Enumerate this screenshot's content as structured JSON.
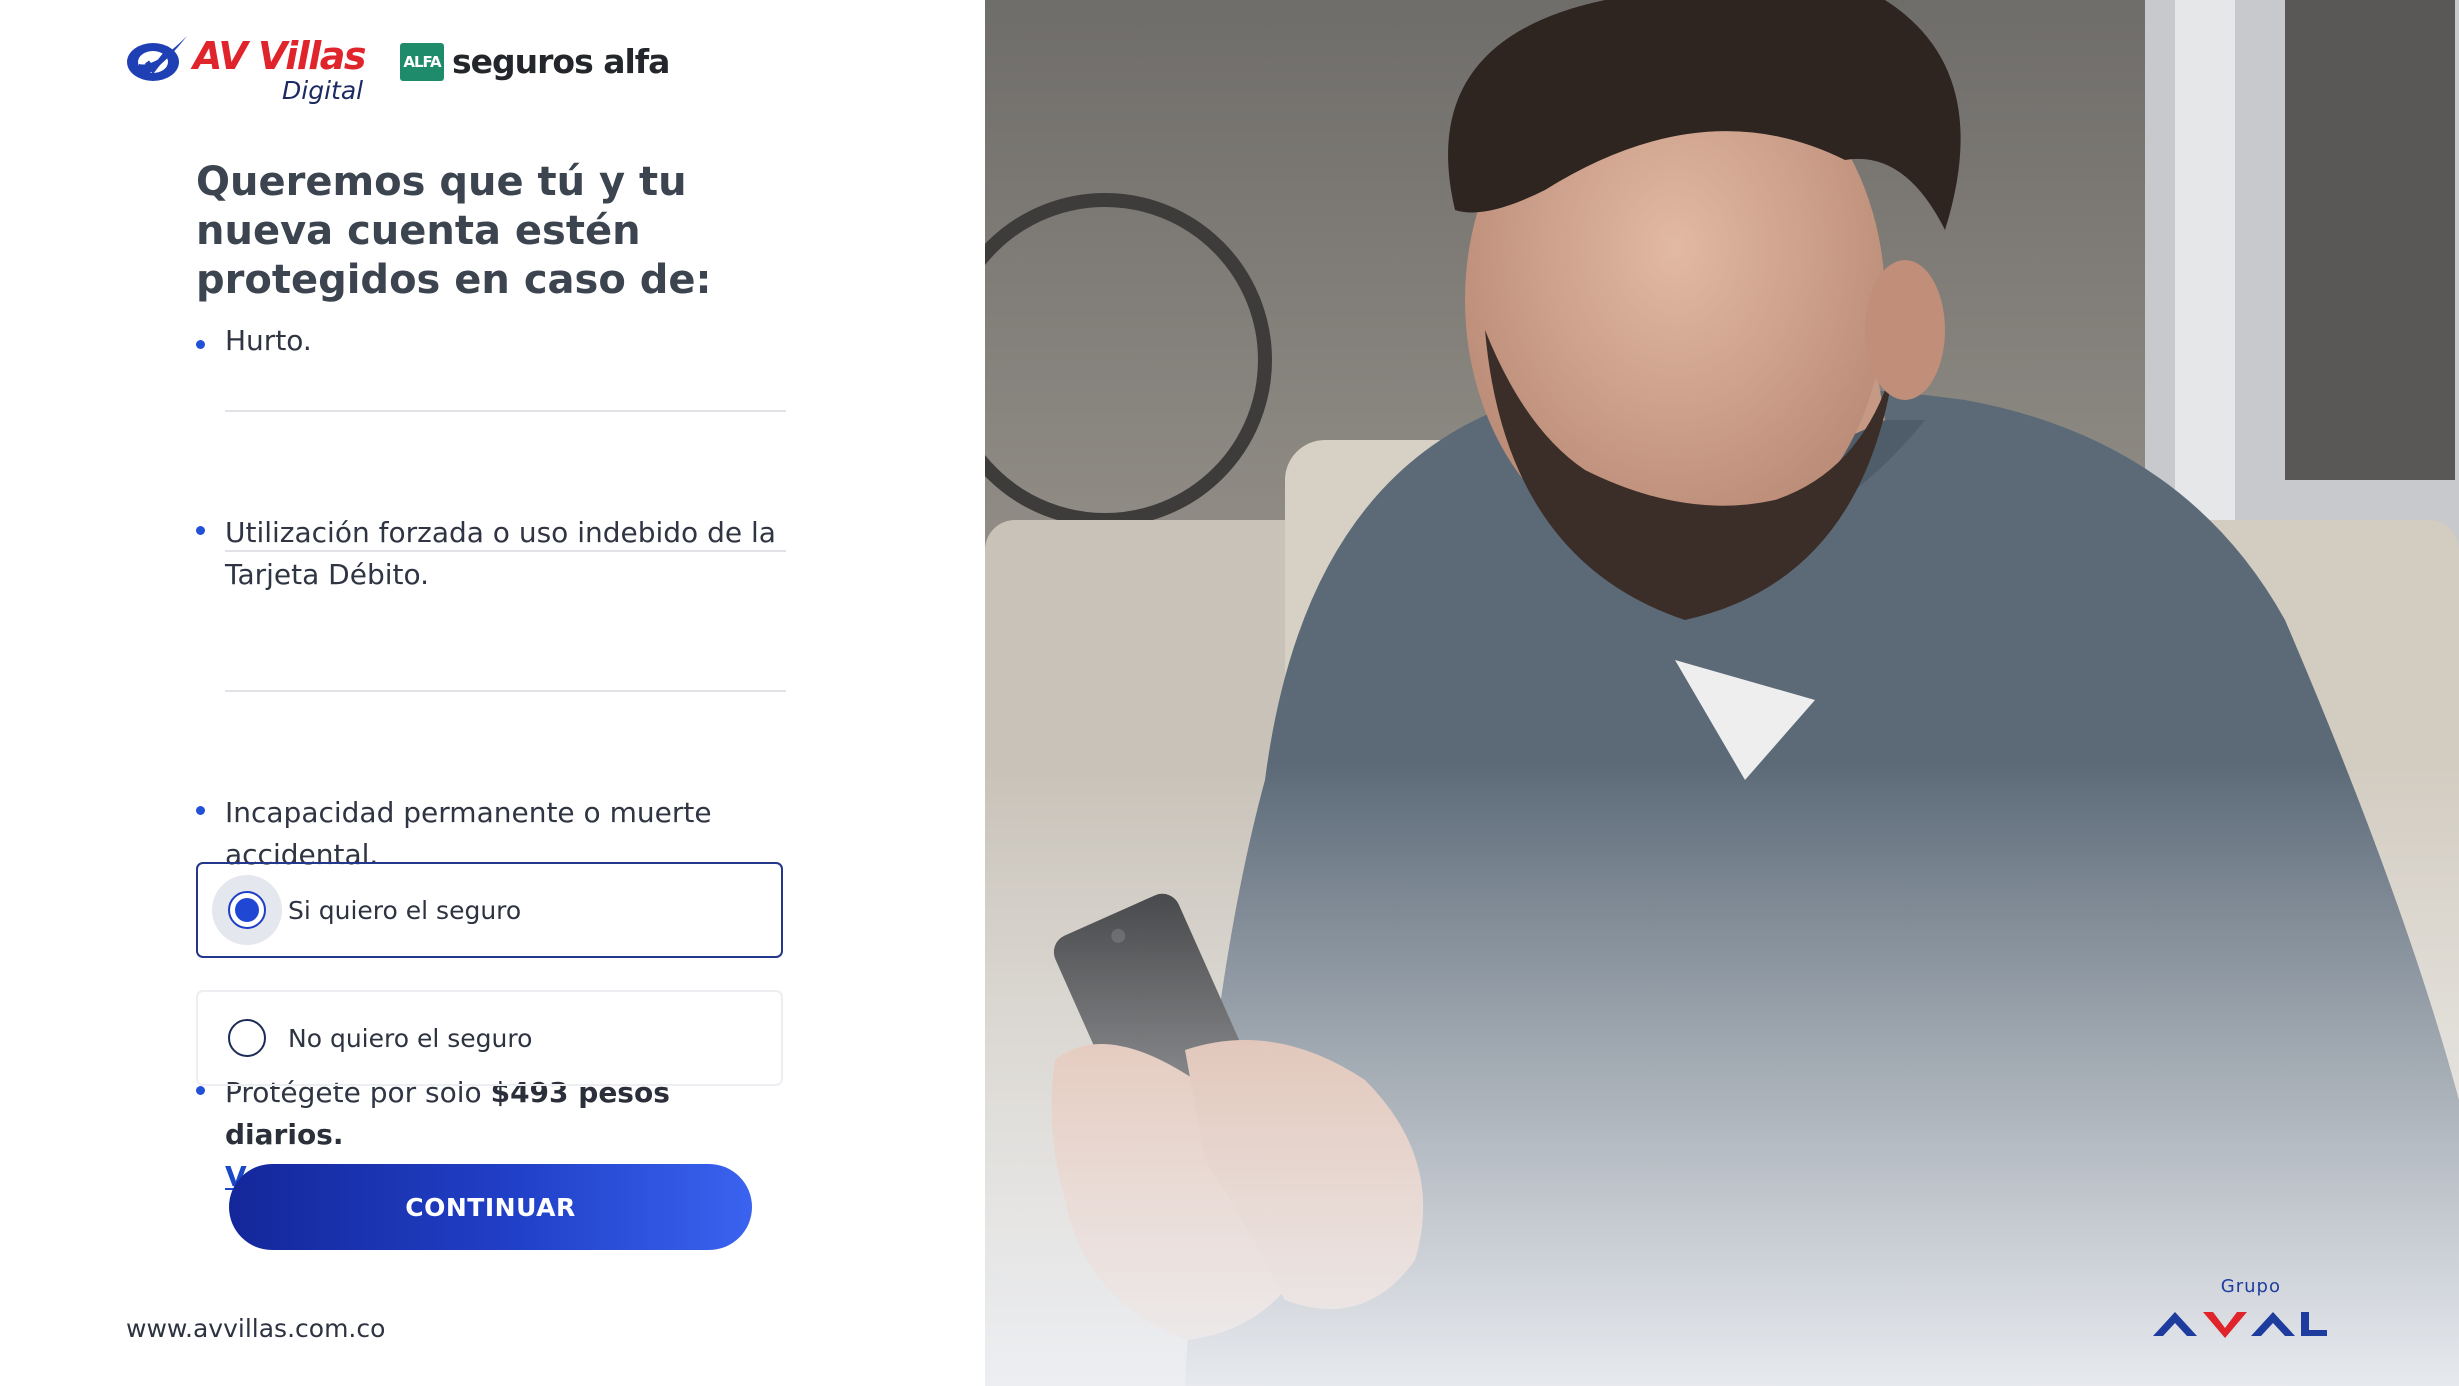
{
  "brand": {
    "av_villas": "AV Villas",
    "av_villas_sub": "Digital",
    "seguros_alfa_mark": "ALFA",
    "seguros_alfa": "seguros alfa"
  },
  "headline": "Queremos que tú y tu nueva cuenta estén protegidos en caso de:",
  "benefits": {
    "item1": "Hurto.",
    "item2": "Utilización forzada o uso indebido de la Tarjeta Débito.",
    "item3": "Incapacidad permanente o muerte accidental.",
    "item4_prefix": "Protégete por solo",
    "item4_price": "$493 pesos diarios.",
    "ver_mas": "Ver más"
  },
  "options": {
    "yes_label": "Si quiero el seguro",
    "no_label": "No quiero el seguro",
    "selected": "yes"
  },
  "continue_label": "CONTINUAR",
  "footer_url": "www.avvillas.com.co",
  "grupo_aval": {
    "grupo": "Grupo",
    "aval": "AVAL"
  },
  "colors": {
    "primary_blue": "#1f47d4",
    "button_dark": "#14279a",
    "button_light": "#3a63f0",
    "av_villas_red": "#e0242b",
    "alfa_green": "#1e8c6a"
  }
}
